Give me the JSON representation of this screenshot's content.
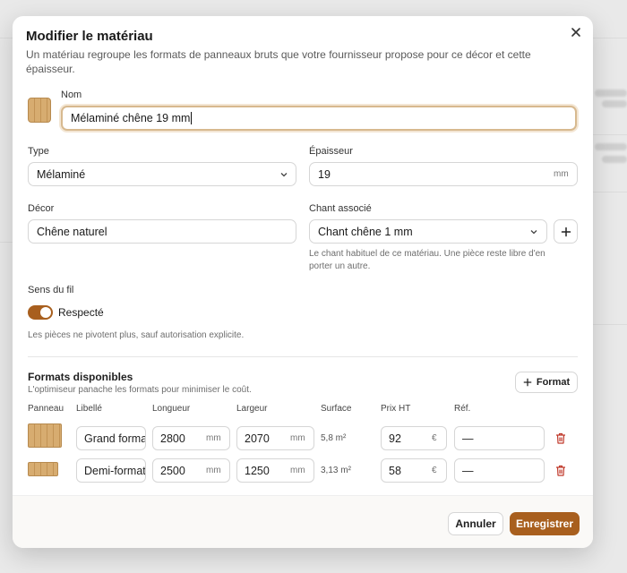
{
  "dialog": {
    "title": "Modifier le matériau",
    "description": "Un matériau regroupe les formats de panneaux bruts que votre fournisseur propose pour ce décor et cette épaisseur."
  },
  "form": {
    "nom": {
      "label": "Nom",
      "value": "Mélaminé chêne 19 mm"
    },
    "type": {
      "label": "Type",
      "value": "Mélaminé"
    },
    "epaisseur": {
      "label": "Épaisseur",
      "value": "19",
      "unit": "mm"
    },
    "decor": {
      "label": "Décor",
      "value": "Chêne naturel"
    },
    "chant": {
      "label": "Chant associé",
      "value": "Chant chêne 1 mm",
      "hint": "Le chant habituel de ce matériau. Une pièce reste libre d'en porter un autre."
    },
    "sens_fil": {
      "label": "Sens du fil",
      "toggle_label": "Respecté",
      "toggle_on": true,
      "hint": "Les pièces ne pivotent plus, sauf autorisation explicite."
    }
  },
  "formats": {
    "title": "Formats disponibles",
    "subtitle": "L'optimiseur panache les formats pour minimiser le coût.",
    "add_label": "Format",
    "headers": [
      "Panneau",
      "Libellé",
      "Longueur",
      "Largeur",
      "Surface",
      "Prix HT",
      "Réf."
    ],
    "rows": [
      {
        "libelle": "Grand format",
        "longueur": "2800",
        "largeur": "2070",
        "surface": "5,8 m²",
        "prix": "92",
        "ref": "—"
      },
      {
        "libelle": "Demi-format",
        "longueur": "2500",
        "largeur": "1250",
        "surface": "3,13 m²",
        "prix": "58",
        "ref": "—"
      }
    ],
    "unit_mm": "mm",
    "currency": "€"
  },
  "footer": {
    "cancel_label": "Annuler",
    "save_label": "Enregistrer"
  },
  "colors": {
    "accent": "#a85f1e",
    "delete": "#c0392b",
    "wood": "#d7ac70"
  }
}
